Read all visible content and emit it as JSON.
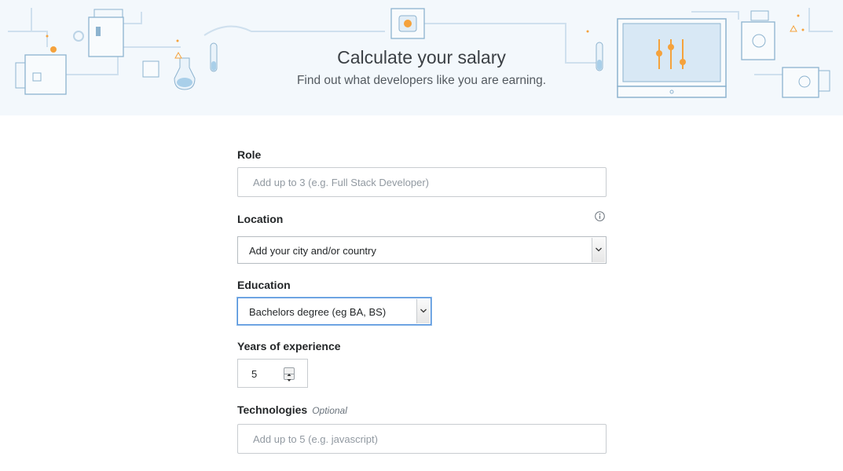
{
  "header": {
    "title": "Calculate your salary",
    "subtitle": "Find out what developers like you are earning."
  },
  "form": {
    "role": {
      "label": "Role",
      "placeholder": "Add up to 3 (e.g. Full Stack Developer)"
    },
    "location": {
      "label": "Location",
      "selected": "Add your city and/or country",
      "info_icon": "info-icon"
    },
    "education": {
      "label": "Education",
      "selected": "Bachelors degree (eg BA, BS)"
    },
    "experience": {
      "label": "Years of experience",
      "value": "5"
    },
    "technologies": {
      "label": "Technologies",
      "optional_label": "Optional",
      "placeholder": "Add up to 5 (e.g. javascript)"
    }
  },
  "colors": {
    "hero_bg": "#f3f8fc",
    "focus_border": "#4f8fdc",
    "accent_orange": "#f48024"
  }
}
